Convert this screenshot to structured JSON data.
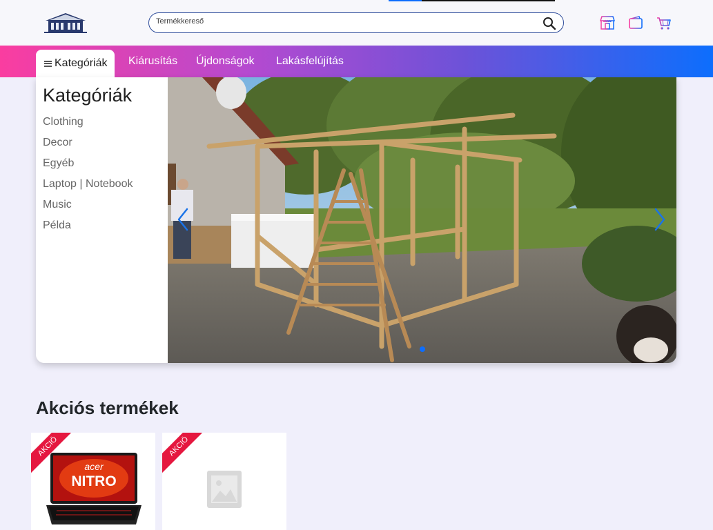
{
  "header": {
    "logo_icon": "house-logo-icon",
    "search_placeholder": "Termékkereső",
    "icons": [
      "store-icon",
      "wallet-icon",
      "cart-icon"
    ]
  },
  "nav": {
    "active_label": "Kategóriák",
    "items": [
      "Kiárusítás",
      "Újdonságok",
      "Lakásfelújítás"
    ]
  },
  "categories": {
    "title": "Kategóriák",
    "items": [
      "Clothing",
      "Decor",
      "Egyéb",
      "Laptop | Notebook",
      "Music",
      "Példa"
    ]
  },
  "carousel": {
    "slide_count": 1,
    "active_index": 0,
    "prev_icon": "chevron-left-icon",
    "next_icon": "chevron-right-icon"
  },
  "sale": {
    "title": "Akciós termékek",
    "products": [
      {
        "badge": "AKCIÓ",
        "image": "acer-nitro-laptop"
      },
      {
        "badge": "AKCIÓ",
        "image": "placeholder-image-icon"
      }
    ]
  },
  "colors": {
    "accent": "#0d6efd",
    "nav_gradient_start": "#fa3da0",
    "nav_gradient_end": "#0d6efd",
    "badge": "#e5173f"
  }
}
